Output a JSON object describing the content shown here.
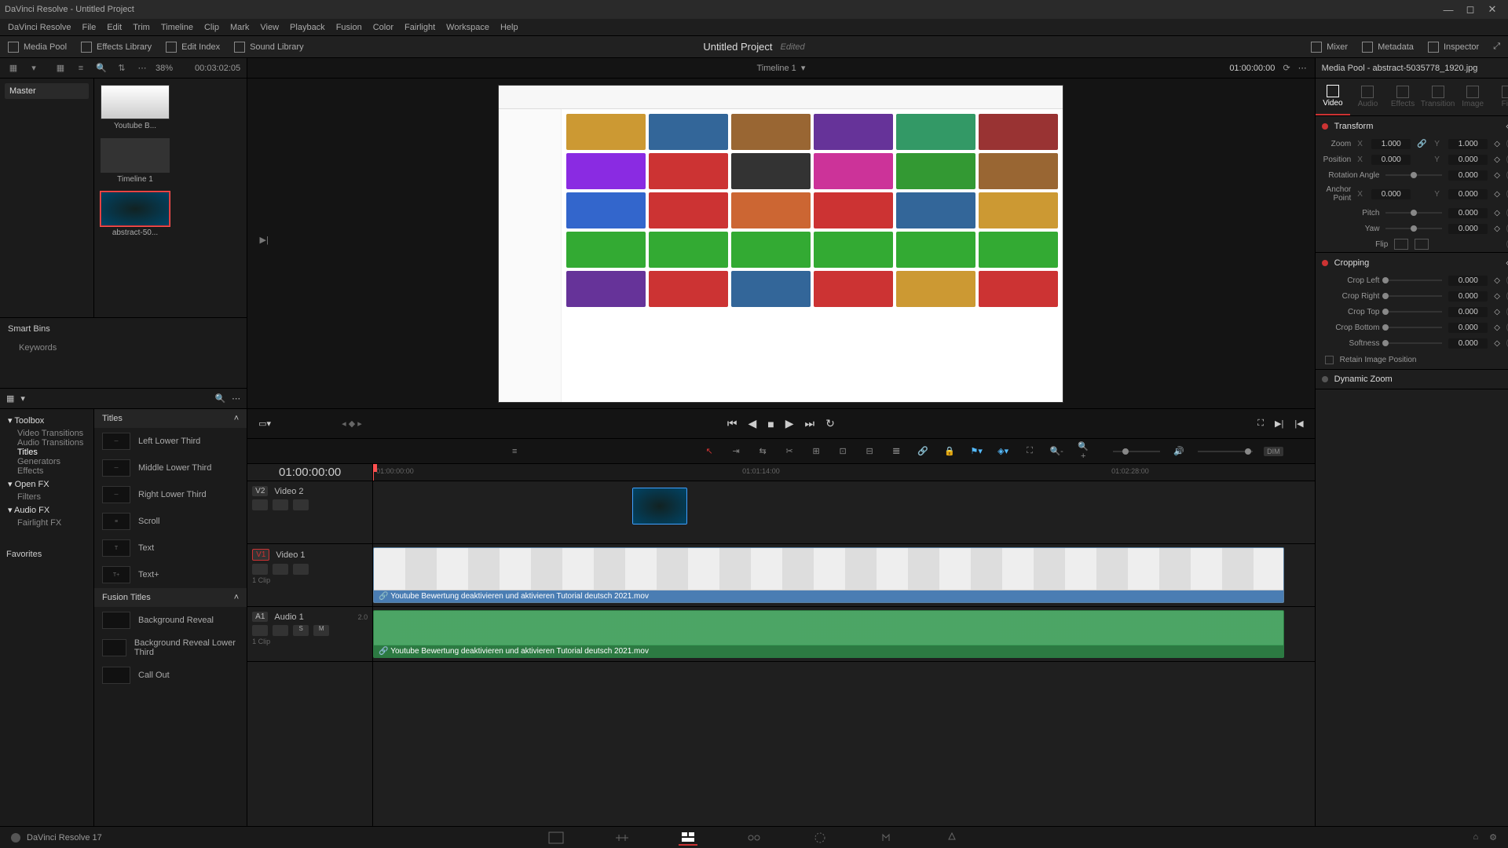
{
  "window": {
    "title": "DaVinci Resolve - Untitled Project"
  },
  "menu": [
    "DaVinci Resolve",
    "File",
    "Edit",
    "Trim",
    "Timeline",
    "Clip",
    "Mark",
    "View",
    "Playback",
    "Fusion",
    "Color",
    "Fairlight",
    "Workspace",
    "Help"
  ],
  "top_toolbar": {
    "media_pool": "Media Pool",
    "effects_library": "Effects Library",
    "edit_index": "Edit Index",
    "sound_library": "Sound Library",
    "project": "Untitled Project",
    "status": "Edited",
    "mixer": "Mixer",
    "metadata": "Metadata",
    "inspector": "Inspector"
  },
  "media_header": {
    "zoom_pct": "38%",
    "timecode": "00:03:02:05"
  },
  "bins": {
    "master": "Master"
  },
  "media_clips": [
    {
      "label": "Youtube B..."
    },
    {
      "label": "Timeline 1"
    },
    {
      "label": "abstract-50...",
      "selected": true
    }
  ],
  "smart_bins": {
    "title": "Smart Bins",
    "items": [
      "Keywords"
    ]
  },
  "effects_tree": {
    "toolbox": "Toolbox",
    "items": [
      "Video Transitions",
      "Audio Transitions",
      "Titles",
      "Generators",
      "Effects"
    ],
    "active": "Titles",
    "openfx": "Open FX",
    "openfx_items": [
      "Filters"
    ],
    "audiofx": "Audio FX",
    "audiofx_items": [
      "Fairlight FX"
    ]
  },
  "titles": {
    "section": "Titles",
    "items": [
      "Left Lower Third",
      "Middle Lower Third",
      "Right Lower Third",
      "Scroll",
      "Text",
      "Text+"
    ],
    "fusion_section": "Fusion Titles",
    "fusion_items": [
      "Background Reveal",
      "Background Reveal Lower Third",
      "Call Out"
    ]
  },
  "favorites": "Favorites",
  "viewer": {
    "timeline_name": "Timeline 1",
    "record_tc": "01:00:00:00"
  },
  "transport": {
    "tc": "01:00:00:00"
  },
  "timeline_ruler": [
    "01:00:00:00",
    "01:01:14:00",
    "01:02:28:00"
  ],
  "tracks": {
    "v2": {
      "tag": "V2",
      "name": "Video 2"
    },
    "v1": {
      "tag": "V1",
      "name": "Video 1",
      "clips": "1 Clip"
    },
    "a1": {
      "tag": "A1",
      "name": "Audio 1",
      "ch": "2.0",
      "clips": "1 Clip"
    }
  },
  "clips": {
    "v2_img": "abstract-50...",
    "v1_name": "Youtube Bewertung deaktivieren und aktivieren Tutorial deutsch 2021.mov",
    "a1_name": "Youtube Bewertung deaktivieren und aktivieren Tutorial deutsch 2021.mov"
  },
  "inspector": {
    "title": "Media Pool - abstract-5035778_1920.jpg",
    "tabs": [
      "Video",
      "Audio",
      "Effects",
      "Transition",
      "Image",
      "File"
    ],
    "active_tab": "Video",
    "transform": {
      "title": "Transform",
      "zoom": "Zoom",
      "zoom_x": "1.000",
      "zoom_y": "1.000",
      "position": "Position",
      "pos_x": "0.000",
      "pos_y": "0.000",
      "rotation": "Rotation Angle",
      "rot_v": "0.000",
      "anchor": "Anchor Point",
      "anc_x": "0.000",
      "anc_y": "0.000",
      "pitch": "Pitch",
      "pitch_v": "0.000",
      "yaw": "Yaw",
      "yaw_v": "0.000",
      "flip": "Flip"
    },
    "cropping": {
      "title": "Cropping",
      "left": "Crop Left",
      "left_v": "0.000",
      "right": "Crop Right",
      "right_v": "0.000",
      "top": "Crop Top",
      "top_v": "0.000",
      "bottom": "Crop Bottom",
      "bottom_v": "0.000",
      "softness": "Softness",
      "soft_v": "0.000",
      "retain": "Retain Image Position"
    },
    "dynamic_zoom": "Dynamic Zoom"
  },
  "footer": {
    "version": "DaVinci Resolve 17"
  }
}
